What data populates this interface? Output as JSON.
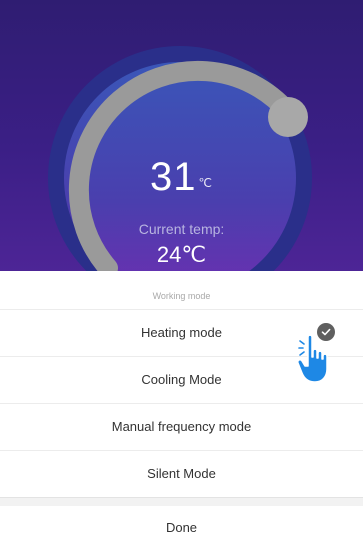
{
  "thermostat": {
    "set_temp": "31",
    "set_unit": "℃",
    "current_label": "Current temp:",
    "current_temp": "24℃"
  },
  "sheet": {
    "title": "Working mode",
    "options": [
      {
        "label": "Heating mode",
        "selected": true
      },
      {
        "label": "Cooling Mode",
        "selected": false
      },
      {
        "label": "Manual frequency mode",
        "selected": false
      },
      {
        "label": "Silent Mode",
        "selected": false
      }
    ],
    "done_label": "Done"
  },
  "icons": {
    "check": "check-icon",
    "pointer": "hand-pointer-icon"
  },
  "colors": {
    "background_top": "#3b1f86",
    "dial_track": "#9a9a9a",
    "dial_face": "#3f3aa8",
    "pointer_hand": "#1e88e5"
  }
}
